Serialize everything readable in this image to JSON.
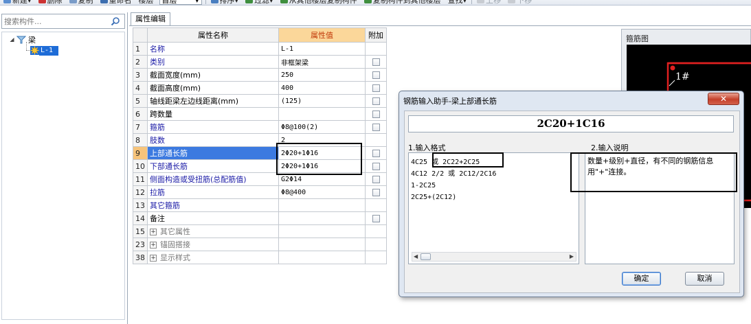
{
  "toolbar": {
    "items": [
      "新建▾",
      "删除",
      "复制",
      "重命名",
      "楼层",
      "首层",
      "排序▾",
      "过滤▾",
      "从其他楼层复制构件",
      "复制构件到其他楼层",
      "查找▾",
      "上移",
      "下移"
    ]
  },
  "left_panel": {
    "search_placeholder": "搜索构件...",
    "tree": {
      "root_label": "梁",
      "child_label": "L-1"
    }
  },
  "tab_label": "属性编辑",
  "props": {
    "headers": [
      "属性名称",
      "属性值",
      "附加"
    ],
    "rows": [
      {
        "num": "1",
        "name": "名称",
        "value": "L-1",
        "blue": true,
        "checkbox": false
      },
      {
        "num": "2",
        "name": "类别",
        "value": "非框架梁",
        "blue": true,
        "checkbox": true
      },
      {
        "num": "3",
        "name": "截面宽度(mm)",
        "value": "250",
        "blue": false,
        "checkbox": true
      },
      {
        "num": "4",
        "name": "截面高度(mm)",
        "value": "400",
        "blue": false,
        "checkbox": true
      },
      {
        "num": "5",
        "name": "轴线距梁左边线距离(mm)",
        "value": "(125)",
        "blue": false,
        "checkbox": true
      },
      {
        "num": "6",
        "name": "跨数量",
        "value": "",
        "blue": false,
        "checkbox": true
      },
      {
        "num": "7",
        "name": "箍筋",
        "value": "Φ8@100(2)",
        "blue": true,
        "checkbox": true
      },
      {
        "num": "8",
        "name": "肢数",
        "value": "2",
        "blue": true,
        "checkbox": false
      },
      {
        "num": "9",
        "name": "上部通长筋",
        "value": "2Φ20+1Φ16",
        "blue": true,
        "checkbox": true,
        "highlight": true
      },
      {
        "num": "10",
        "name": "下部通长筋",
        "value": "2Φ20+1Φ16",
        "blue": true,
        "checkbox": true
      },
      {
        "num": "11",
        "name": "侧面构造或受扭筋(总配筋值)",
        "value": "G2Φ14",
        "blue": true,
        "checkbox": true
      },
      {
        "num": "12",
        "name": "拉筋",
        "value": "Φ8@400",
        "blue": true,
        "checkbox": true
      },
      {
        "num": "13",
        "name": "其它箍筋",
        "value": "",
        "blue": true,
        "checkbox": false
      },
      {
        "num": "14",
        "name": "备注",
        "value": "",
        "blue": false,
        "checkbox": true
      },
      {
        "num": "15",
        "name": "其它属性",
        "value": "",
        "group": true
      },
      {
        "num": "23",
        "name": "锚固搭接",
        "value": "",
        "group": true
      },
      {
        "num": "38",
        "name": "显示样式",
        "value": "",
        "group": true
      }
    ]
  },
  "image_panel": {
    "title": "箍筋图",
    "label": "1#"
  },
  "dialog": {
    "title": "钢筋输入助手-梁上部通长筋",
    "close_label": "✕",
    "formula": "2C20+1C16",
    "section1": "1.输入格式",
    "section2": "2.输入说明",
    "formats": [
      "4C25 或 2C22+2C25",
      "4C12 2/2 或 2C12/2C16",
      "1-2C25",
      "2C25+(2C12)"
    ],
    "description": "数量+级别+直径，有不同的钢筋信息用\"+\"连接。",
    "ok_label": "确定",
    "cancel_label": "取消"
  }
}
